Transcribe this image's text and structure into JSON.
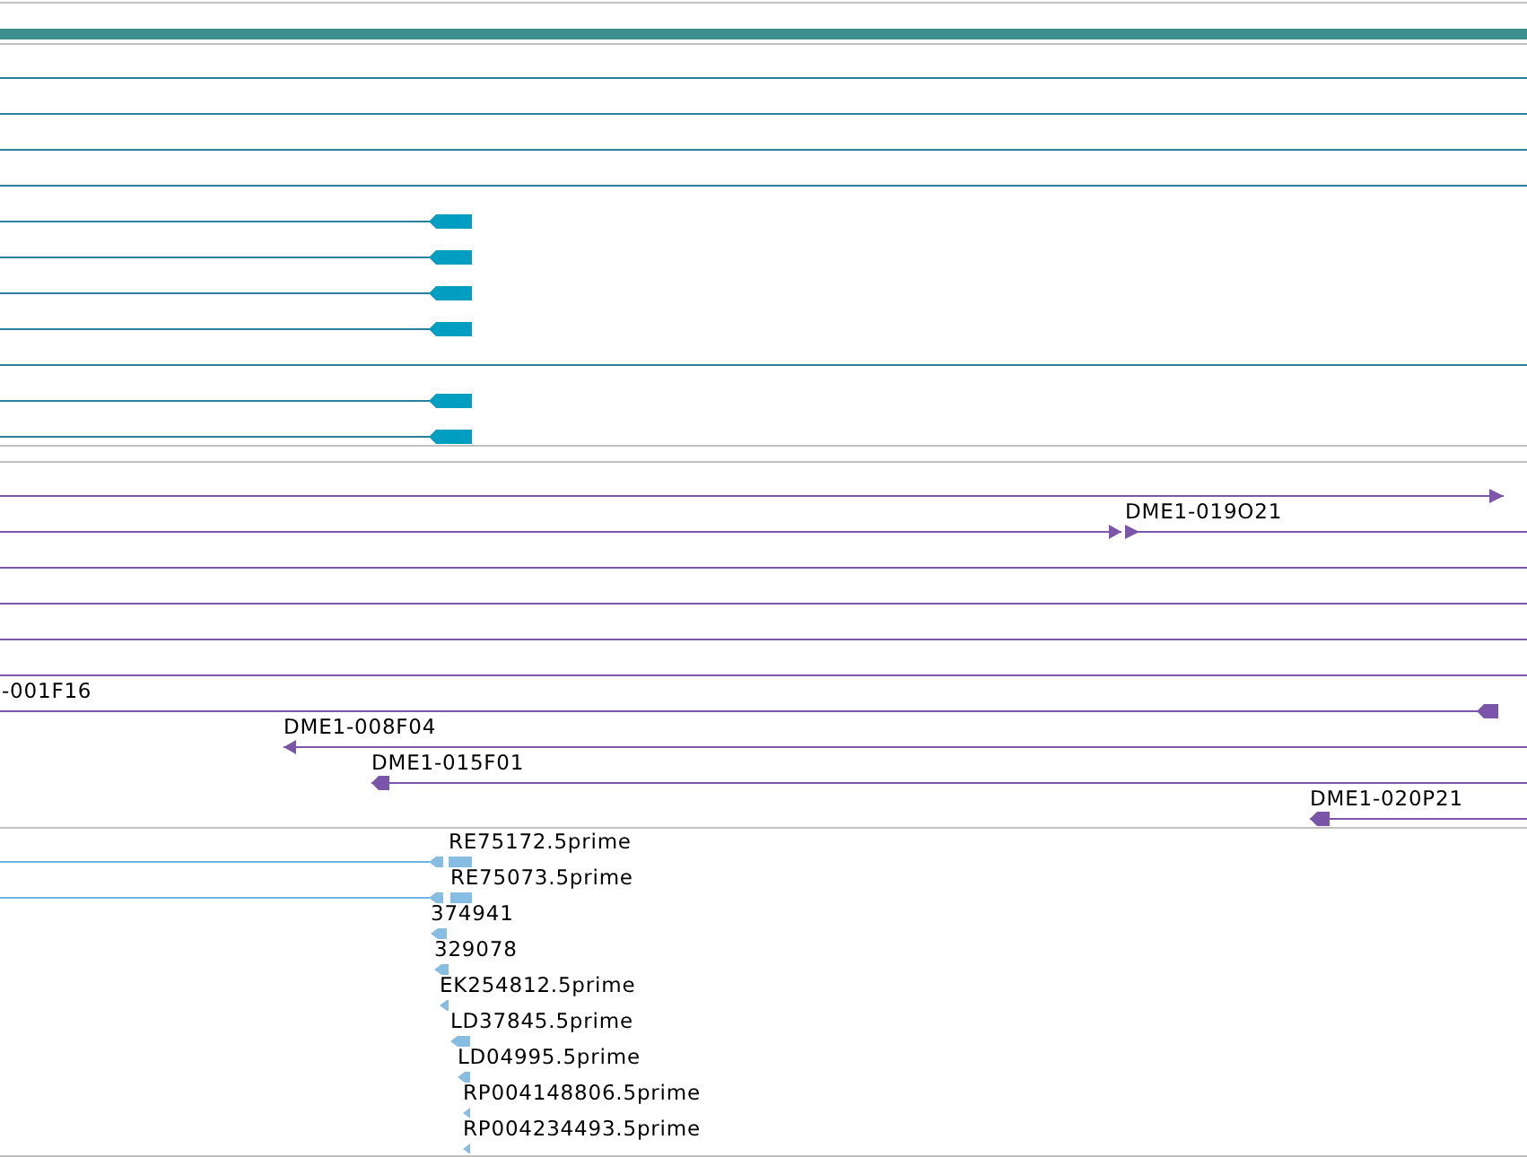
{
  "tracks": [
    {
      "kind": "gene_models",
      "features": [
        {
          "kind": "line"
        },
        {
          "kind": "line"
        },
        {
          "kind": "line"
        },
        {
          "kind": "line"
        },
        {
          "kind": "arrow",
          "reverse": true
        },
        {
          "kind": "arrow",
          "reverse": true
        },
        {
          "kind": "arrow",
          "reverse": true
        },
        {
          "kind": "arrow",
          "reverse": true
        },
        {
          "kind": "line"
        },
        {
          "kind": "arrow",
          "reverse": true
        },
        {
          "kind": "arrow",
          "reverse": true
        }
      ]
    },
    {
      "kind": "clones",
      "features": [
        {
          "kind": "arrow",
          "reverse": false
        },
        {
          "kind": "arrow",
          "reverse": false
        },
        {
          "kind": "arrow",
          "label": "DME1-019O21",
          "reverse": false
        },
        {
          "kind": "line"
        },
        {
          "kind": "line"
        },
        {
          "kind": "line"
        },
        {
          "kind": "line"
        },
        {
          "kind": "arrow",
          "label": "-001F16",
          "reverse": true
        },
        {
          "kind": "arrow",
          "label": "DME1-008F04",
          "reverse": true
        },
        {
          "kind": "arrow",
          "label": "DME1-015F01",
          "reverse": true
        },
        {
          "kind": "arrow",
          "label": "DME1-020P21",
          "reverse": true
        }
      ]
    },
    {
      "kind": "ests",
      "features": [
        {
          "kind": "arrow",
          "label": "RE75172.5prime",
          "reverse": true
        },
        {
          "kind": "arrow",
          "label": "RE75073.5prime",
          "reverse": true
        },
        {
          "kind": "arrow",
          "label": "374941",
          "reverse": true
        },
        {
          "kind": "arrow",
          "label": "329078",
          "reverse": true
        },
        {
          "kind": "arrow",
          "label": "EK254812.5prime",
          "reverse": true
        },
        {
          "kind": "arrow",
          "label": "LD37845.5prime",
          "reverse": true
        },
        {
          "kind": "arrow",
          "label": "LD04995.5prime",
          "reverse": true
        },
        {
          "kind": "arrow",
          "label": "RP004148806.5prime",
          "reverse": true
        },
        {
          "kind": "arrow",
          "label": "RP004234493.5prime",
          "reverse": true
        }
      ]
    }
  ]
}
